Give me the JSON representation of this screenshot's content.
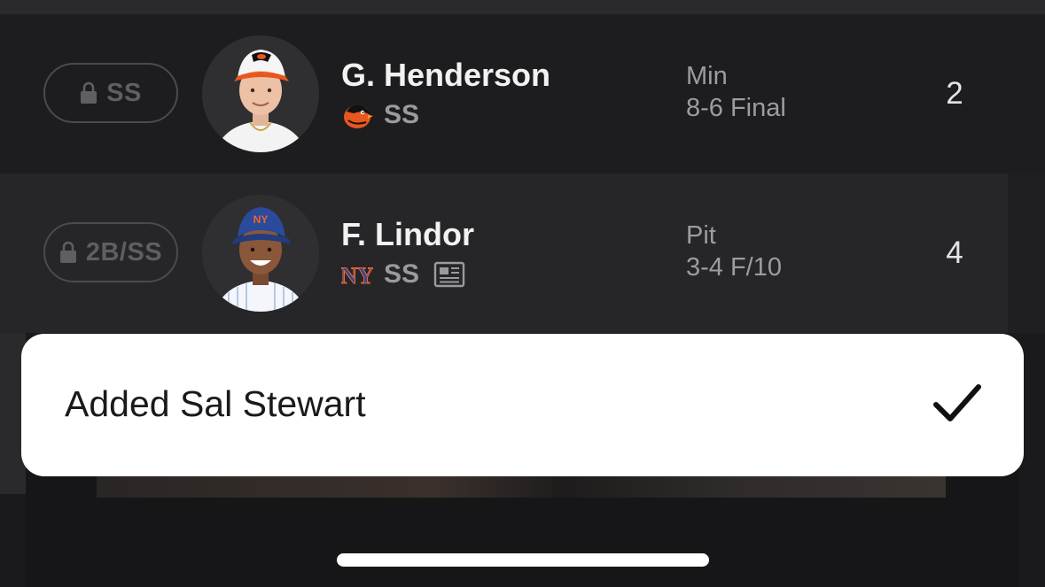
{
  "roster": {
    "rows": [
      {
        "slot": "SS",
        "player_name": "G. Henderson",
        "team_icon": "orioles-logo-icon",
        "position": "SS",
        "opponent": "Min",
        "result": "8-6 Final",
        "stat_value": "2",
        "has_news": false
      },
      {
        "slot": "2B/SS",
        "player_name": "F. Lindor",
        "team_icon": "mets-logo-icon",
        "position": "SS",
        "opponent": "Pit",
        "result": "3-4 F/10",
        "stat_value": "4",
        "has_news": true
      }
    ]
  },
  "toast": {
    "message": "Added Sal Stewart",
    "icon": "checkmark-icon"
  },
  "colors": {
    "background": "#1b1b1d",
    "row_alt": "#262628",
    "muted_text": "#9c9ca1",
    "toast_bg": "#ffffff",
    "orioles_orange": "#e8571f",
    "mets_blue": "#2a4a9b",
    "mets_orange": "#f0662a"
  }
}
